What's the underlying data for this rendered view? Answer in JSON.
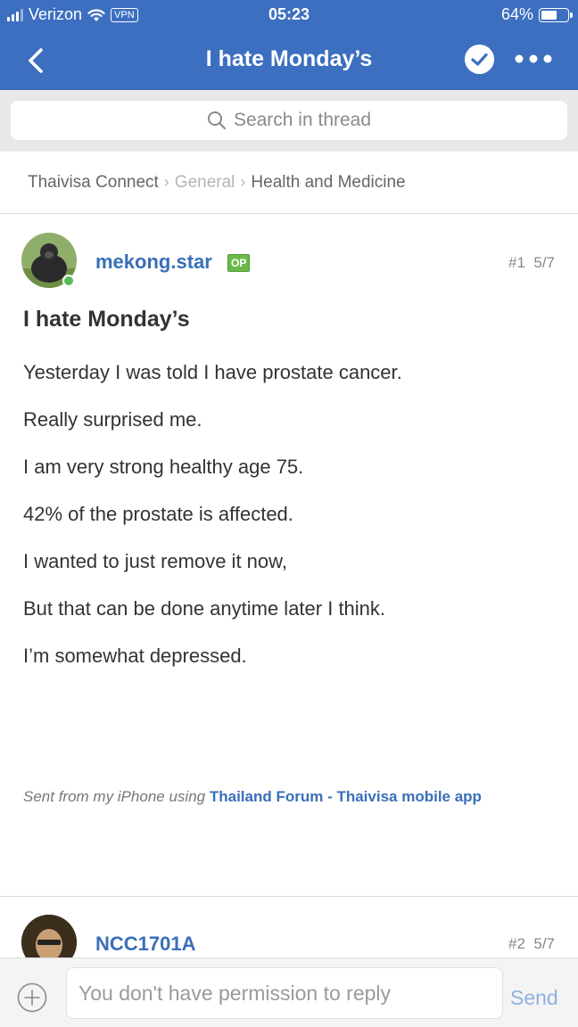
{
  "status_bar": {
    "carrier": "Verizon",
    "vpn_label": "VPN",
    "time": "05:23",
    "battery_text": "64%",
    "battery_level": 0.64
  },
  "nav": {
    "title": "I hate Monday’s",
    "back_icon": "chevron-left-icon",
    "check_icon": "check-circle-icon",
    "more_icon": "more-dots-icon"
  },
  "search": {
    "placeholder": "Search in thread"
  },
  "breadcrumb": {
    "items": [
      "Thaivisa Connect",
      "General",
      "Health and Medicine"
    ]
  },
  "post1": {
    "author": "mekong.star",
    "badge": "OP",
    "number": "#1",
    "date": "5/7",
    "title": "I hate Monday’s",
    "lines": [
      "Yesterday I was told I have prostate cancer.",
      "Really surprised me.",
      "I am very strong healthy age 75.",
      "42% of the prostate is affected.",
      "I wanted to just remove it now,",
      "But that can be done anytime later I think.",
      "I’m somewhat depressed."
    ],
    "signature_prefix": "Sent from my iPhone using",
    "signature_link": "Thailand Forum - Thaivisa mobile app"
  },
  "post2": {
    "author": "NCC1701A",
    "number": "#2",
    "date": "5/7"
  },
  "reply": {
    "placeholder": "You don't have permission to reply",
    "send_label": "Send"
  },
  "colors": {
    "header_blue": "#3d6fc0",
    "link_blue": "#3a6fb8",
    "op_green": "#6cb94a",
    "online_green": "#5cb85c"
  }
}
